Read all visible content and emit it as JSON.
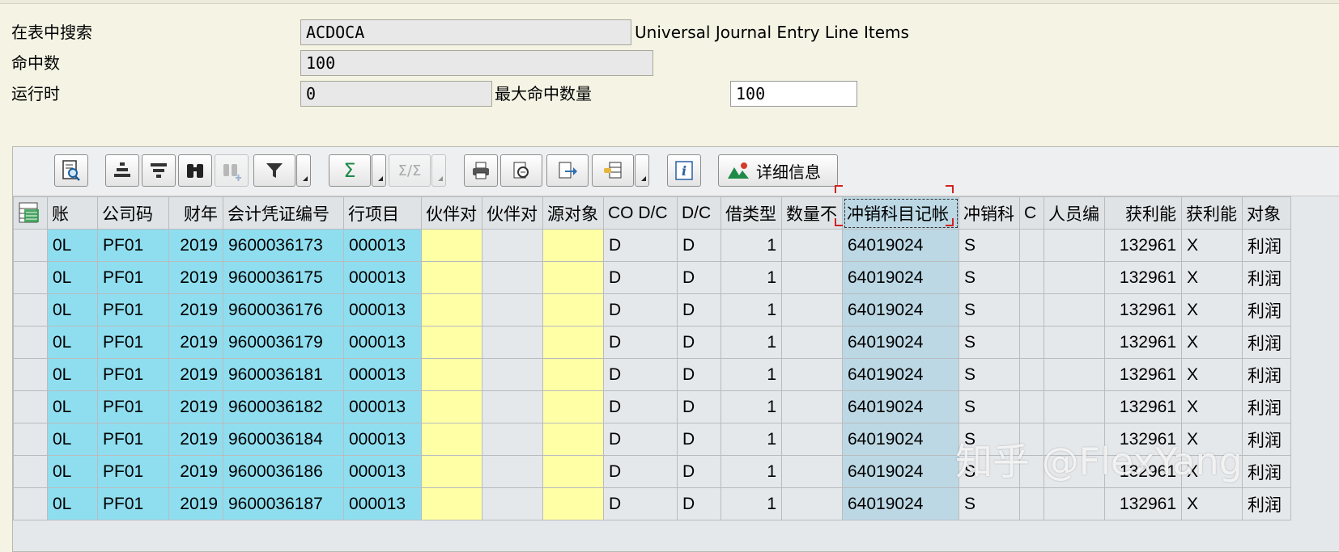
{
  "header": {
    "search_label": "在表中搜索",
    "table_name": "ACDOCA",
    "table_desc": "Universal Journal Entry Line Items",
    "hits_label": "命中数",
    "hits_value": "100",
    "runtime_label": "运行时",
    "runtime_value": "0",
    "max_hits_label": "最大命中数量",
    "max_hits_value": "100"
  },
  "toolbar": {
    "buttons": [
      "details-icon",
      "align-center-icon",
      "filter-list-icon",
      "binoculars-icon",
      "binoculars-next-icon",
      "filter-funnel-icon",
      "sum-icon",
      "subtotal-icon",
      "print-icon",
      "export-view-icon",
      "export-icon",
      "layout-icon",
      "info-icon",
      "detail-info-icon"
    ],
    "detail_label": "详细信息"
  },
  "colors": {
    "key": "#8fdeef",
    "yellow": "#ffffa6",
    "selected": "#bcd8e4"
  },
  "table": {
    "columns": [
      "账",
      "公司码",
      "财年",
      "会计凭证编号",
      "行项目",
      "伙伴对",
      "伙伴对",
      "源对象",
      "CO D/C",
      "D/C",
      "借类型",
      "数量不",
      "冲销科目记帐",
      "冲销科",
      "C",
      "人员编",
      "获利能",
      "获利能",
      "对象"
    ],
    "rows": [
      [
        "0L",
        "PF01",
        "2019",
        "9600036173",
        "000013",
        "",
        "",
        "",
        "D",
        "D",
        "1",
        "",
        "64019024",
        "S",
        "",
        "",
        "132961",
        "X",
        "利润"
      ],
      [
        "0L",
        "PF01",
        "2019",
        "9600036175",
        "000013",
        "",
        "",
        "",
        "D",
        "D",
        "1",
        "",
        "64019024",
        "S",
        "",
        "",
        "132961",
        "X",
        "利润"
      ],
      [
        "0L",
        "PF01",
        "2019",
        "9600036176",
        "000013",
        "",
        "",
        "",
        "D",
        "D",
        "1",
        "",
        "64019024",
        "S",
        "",
        "",
        "132961",
        "X",
        "利润"
      ],
      [
        "0L",
        "PF01",
        "2019",
        "9600036179",
        "000013",
        "",
        "",
        "",
        "D",
        "D",
        "1",
        "",
        "64019024",
        "S",
        "",
        "",
        "132961",
        "X",
        "利润"
      ],
      [
        "0L",
        "PF01",
        "2019",
        "9600036181",
        "000013",
        "",
        "",
        "",
        "D",
        "D",
        "1",
        "",
        "64019024",
        "S",
        "",
        "",
        "132961",
        "X",
        "利润"
      ],
      [
        "0L",
        "PF01",
        "2019",
        "9600036182",
        "000013",
        "",
        "",
        "",
        "D",
        "D",
        "1",
        "",
        "64019024",
        "S",
        "",
        "",
        "132961",
        "X",
        "利润"
      ],
      [
        "0L",
        "PF01",
        "2019",
        "9600036184",
        "000013",
        "",
        "",
        "",
        "D",
        "D",
        "1",
        "",
        "64019024",
        "S",
        "",
        "",
        "132961",
        "X",
        "利润"
      ],
      [
        "0L",
        "PF01",
        "2019",
        "9600036186",
        "000013",
        "",
        "",
        "",
        "D",
        "D",
        "1",
        "",
        "64019024",
        "S",
        "",
        "",
        "132961",
        "X",
        "利润"
      ],
      [
        "0L",
        "PF01",
        "2019",
        "9600036187",
        "000013",
        "",
        "",
        "",
        "D",
        "D",
        "1",
        "",
        "64019024",
        "S",
        "",
        "",
        "132961",
        "X",
        "利润"
      ]
    ]
  },
  "watermark": "知乎 @FlexYang"
}
